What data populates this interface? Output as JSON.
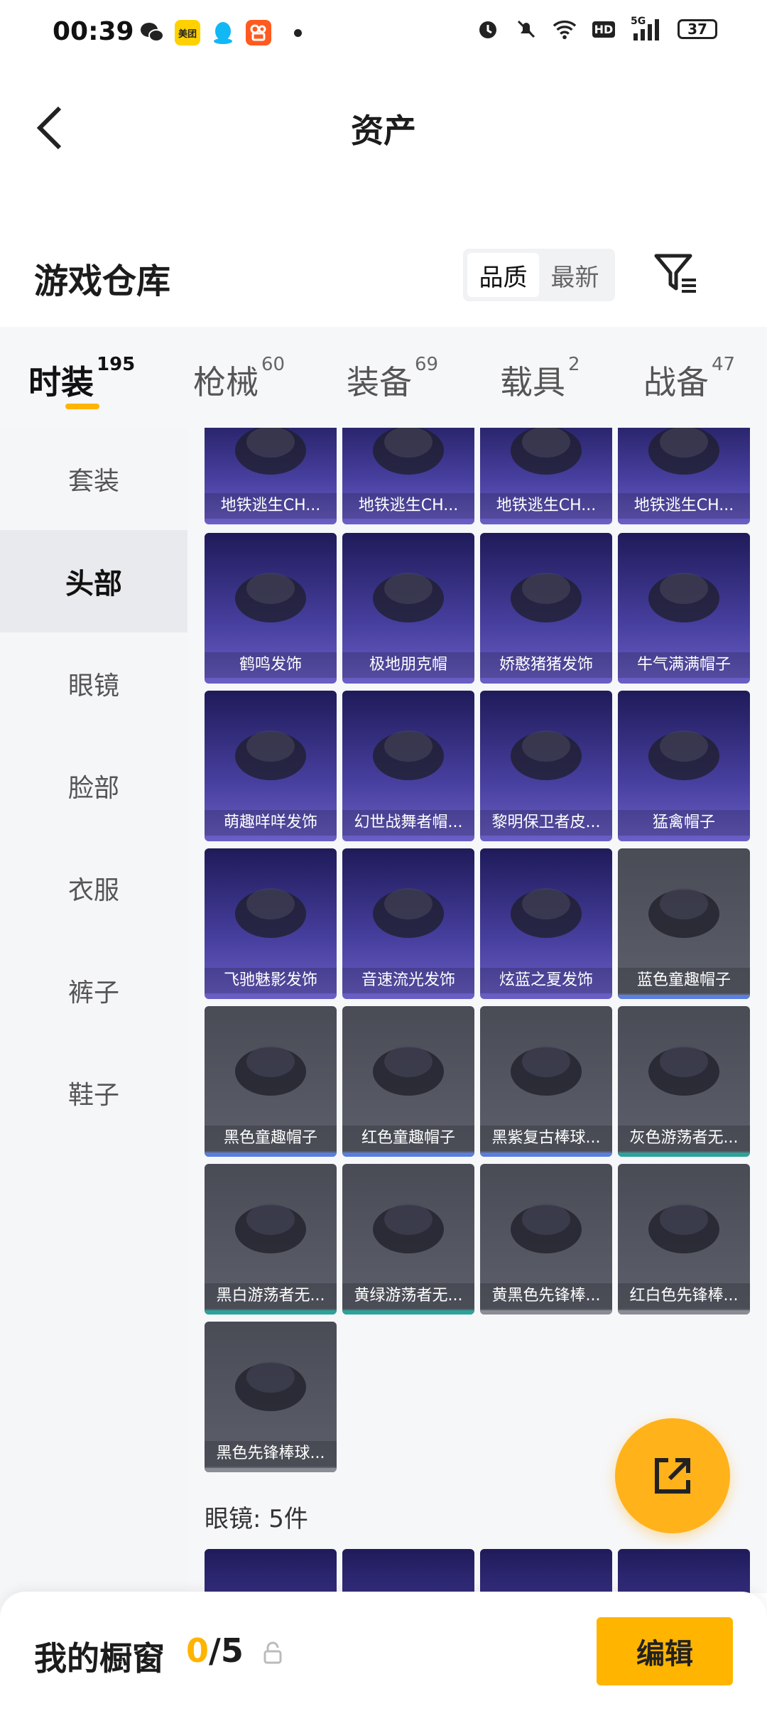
{
  "status_bar": {
    "time": "00:39",
    "apps": [
      {
        "icon": "wechat-icon",
        "text": ""
      },
      {
        "icon": "meituan-icon",
        "text": "美团"
      },
      {
        "icon": "qq-icon",
        "text": ""
      },
      {
        "icon": "kuaishou-icon",
        "text": ""
      }
    ],
    "battery": "37",
    "network": "5G",
    "hd": "HD"
  },
  "header": {
    "title": "资产"
  },
  "warehouse": {
    "title": "游戏仓库",
    "sort_options": [
      "品质",
      "最新"
    ],
    "active_sort": 0
  },
  "tabs": [
    {
      "label": "时装",
      "count": "195",
      "active": true
    },
    {
      "label": "枪械",
      "count": "60"
    },
    {
      "label": "装备",
      "count": "69"
    },
    {
      "label": "载具",
      "count": "2"
    },
    {
      "label": "战备",
      "count": "47"
    }
  ],
  "sidebar": {
    "items": [
      "套装",
      "头部",
      "眼镜",
      "脸部",
      "衣服",
      "裤子",
      "鞋子"
    ],
    "active_index": 1
  },
  "items": [
    {
      "name": "地铁逃生CH...",
      "style": "purple"
    },
    {
      "name": "地铁逃生CH...",
      "style": "purple"
    },
    {
      "name": "地铁逃生CH...",
      "style": "purple"
    },
    {
      "name": "地铁逃生CH...",
      "style": "purple"
    },
    {
      "name": "鹤鸣发饰",
      "style": "purple"
    },
    {
      "name": "极地朋克帽",
      "style": "purple"
    },
    {
      "name": "娇憨猪猪发饰",
      "style": "purple"
    },
    {
      "name": "牛气满满帽子",
      "style": "purple"
    },
    {
      "name": "萌趣咩咩发饰",
      "style": "purple"
    },
    {
      "name": "幻世战舞者帽...",
      "style": "purple"
    },
    {
      "name": "黎明保卫者皮...",
      "style": "purple"
    },
    {
      "name": "猛禽帽子",
      "style": "purple"
    },
    {
      "name": "飞驰魅影发饰",
      "style": "purple"
    },
    {
      "name": "音速流光发饰",
      "style": "purple"
    },
    {
      "name": "炫蓝之夏发饰",
      "style": "purple"
    },
    {
      "name": "蓝色童趣帽子",
      "style": "grey",
      "rarity": "#5a7de0"
    },
    {
      "name": "黑色童趣帽子",
      "style": "grey",
      "rarity": "#5a7de0"
    },
    {
      "name": "红色童趣帽子",
      "style": "grey",
      "rarity": "#5a7de0"
    },
    {
      "name": "黑紫复古棒球...",
      "style": "grey",
      "rarity": "#5a7de0"
    },
    {
      "name": "灰色游荡者无...",
      "style": "grey",
      "rarity": "#2aa39a"
    },
    {
      "name": "黑白游荡者无...",
      "style": "grey",
      "rarity": "#2aa39a"
    },
    {
      "name": "黄绿游荡者无...",
      "style": "grey",
      "rarity": "#2aa39a"
    },
    {
      "name": "黄黑色先锋棒...",
      "style": "grey",
      "rarity": "#8a8d96"
    },
    {
      "name": "红白色先锋棒...",
      "style": "grey",
      "rarity": "#8a8d96"
    },
    {
      "name": "黑色先锋棒球...",
      "style": "grey",
      "rarity": "#8a8d96"
    }
  ],
  "glasses_section": {
    "label": "眼镜: 5件"
  },
  "bottom_bar": {
    "title": "我的橱窗",
    "current": "0",
    "total": "/5",
    "edit_label": "编辑"
  },
  "colors": {
    "accent": "#ffb400",
    "purple_card": "#473f9e",
    "grey_card": "#5d606b"
  }
}
